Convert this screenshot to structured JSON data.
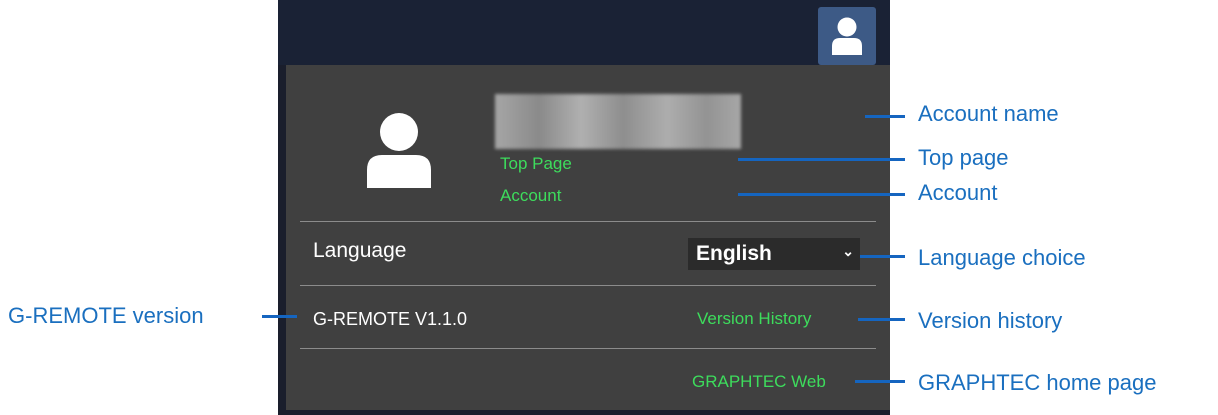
{
  "menu": {
    "top_page_link": "Top Page",
    "account_link": "Account",
    "language_label": "Language",
    "language_selected": "English",
    "version_text": "G-REMOTE V1.1.0",
    "version_history_link": "Version History",
    "web_link": "GRAPHTEC Web"
  },
  "annotations": {
    "account_name": "Account name",
    "top_page": "Top page",
    "account": "Account",
    "language_choice": "Language choice",
    "gremote_version": "G-REMOTE version",
    "version_history": "Version history",
    "home_page": "GRAPHTEC home page"
  },
  "icons": {
    "header_avatar": "user-icon",
    "profile_avatar": "user-icon",
    "select_arrow": "chevron-down-icon"
  },
  "colors": {
    "header_bg": "#1a2235",
    "menu_bg": "#404040",
    "link": "#3ddc5c",
    "avatar_button": "#3d5a86",
    "annotation": "#1a6fbf"
  }
}
